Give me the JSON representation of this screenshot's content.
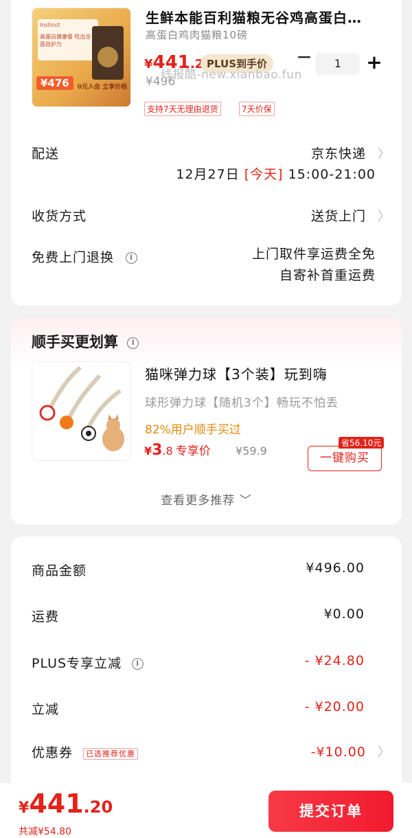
{
  "product": {
    "title": "生鲜本能百利猫粮无谷鸡高蛋白…",
    "subtitle": "高蛋白鸡肉猫粮10磅",
    "price_symbol": "¥",
    "price_int": "441",
    "price_dec": ".2",
    "plus_label": "PLUS到手价",
    "original_price": "¥496",
    "quantity": "1",
    "minus": "−",
    "plus": "+",
    "services": [
      "支持7天无理由退货",
      "7天价保"
    ],
    "thumb": {
      "brand": "Instinct",
      "headline": "高蛋白健康餐 吃出全面自护力",
      "price": "¥476",
      "join": "0元入会 立享价格"
    }
  },
  "watermark": "线报酷-new.xianbao.fun",
  "delivery": {
    "label": "配送",
    "carrier": "京东快递",
    "date": "12月27日",
    "today": "[今天]",
    "time": "15:00-21:00"
  },
  "receive": {
    "label": "收货方式",
    "value": "送货上门"
  },
  "free_return": {
    "label": "免费上门退换",
    "line1": "上门取件享运费全免",
    "line2": "自寄补首重运费"
  },
  "addon": {
    "section_title": "顺手买更划算",
    "name": "猫咪弹力球【3个装】玩到嗨",
    "desc": "球形弹力球【随机3个】畅玩不怕丢",
    "bought": "82%用户顺手买过",
    "price_symbol": "¥",
    "price_int": "3",
    "price_dec": ".8",
    "price_label": "专享价",
    "original_price": "¥59.9",
    "save_tag": "省56.10元",
    "buy_label": "一键购买",
    "more": "查看更多推荐 ﹀"
  },
  "summary": {
    "items": [
      {
        "label": "商品金额",
        "value": "¥496.00"
      },
      {
        "label": "运费",
        "value": "¥0.00"
      },
      {
        "label": "PLUS专享立减",
        "value": "- ¥24.80"
      },
      {
        "label": "立减",
        "value": "- ¥20.00"
      },
      {
        "label": "优惠券",
        "value": "-¥10.00"
      }
    ],
    "coupon_tag": "已选推荐优惠"
  },
  "footer": {
    "symbol": "¥",
    "total_int": "441",
    "total_dec": ".20",
    "saved": "共减¥54.80",
    "submit": "提交订单"
  },
  "colors": {
    "accent": "#e2231a",
    "plus_tag_bg": "#f4e6cf",
    "background": "#f2f2f2"
  }
}
